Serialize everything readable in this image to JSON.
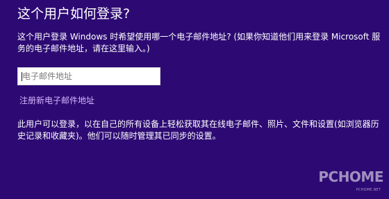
{
  "page": {
    "title": "这个用户如何登录?",
    "prompt_lines": [
      "这个用户登录 Windows 时希望使用哪一个电子邮件地址? (如果你知道他们用来登录 Microsoft 服",
      "务的电子邮件地址，请在这里输入。)"
    ],
    "email_input": {
      "value": "",
      "placeholder": "电子邮件地址"
    },
    "register_link_label": "注册新电子邮件地址",
    "info_lines": [
      "此用户可以登录，以在自己的所有设备上轻松获取其在线电子邮件、照片、文件和设置(如浏览器历",
      "史记录和收藏夹)。他们可以随时管理其已同步的设置。"
    ]
  },
  "watermark": {
    "logo_text": "PCHOME",
    "small_text": "PCHOME.NET"
  },
  "colors": {
    "background": "#2d0a73",
    "text": "#ffffff",
    "link": "#d6b6ff",
    "input_background": "#ffffff"
  }
}
